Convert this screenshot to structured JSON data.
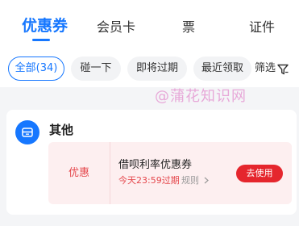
{
  "tabs": [
    {
      "label": "优惠券",
      "active": true
    },
    {
      "label": "会员卡",
      "active": false
    },
    {
      "label": "票",
      "active": false
    },
    {
      "label": "证件",
      "active": false
    }
  ],
  "filters": {
    "chips": [
      {
        "label": "全部(34)",
        "active": true
      },
      {
        "label": "碰一下",
        "active": false
      },
      {
        "label": "即将过期",
        "active": false
      },
      {
        "label": "最近领取",
        "active": false
      }
    ],
    "filter_label": "筛选",
    "filter_icon": "funnel-icon"
  },
  "watermark": "@蒲花知识网",
  "category": {
    "icon": "coupon-icon",
    "title": "其他"
  },
  "coupon": {
    "badge": "优惠",
    "name": "借呗利率优惠券",
    "expire": "今天23:59过期",
    "rules": "规则",
    "action": "去使用"
  },
  "colors": {
    "accent": "#1677ff",
    "coupon_red": "#e5262d",
    "coupon_bg": "#fdeff0",
    "watermark": "#e7a8d8"
  }
}
